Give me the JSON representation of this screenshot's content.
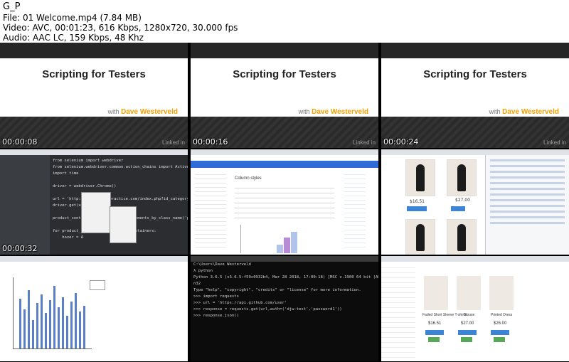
{
  "header": {
    "title": "G_P",
    "file": "File: 01 Welcome.mp4 (7.84 MB)",
    "video": "Video: AVC, 00:01:23, 616 Kbps, 1280x720, 30.000 fps",
    "audio": "Audio: AAC LC, 159 Kbps, 48 Khz"
  },
  "slide": {
    "title": "Scripting for Testers",
    "with": "with",
    "author": "Dave Westerveld",
    "watermark": "Linked in"
  },
  "thumbnails": [
    {
      "timestamp": "00:00:08"
    },
    {
      "timestamp": "00:00:16"
    },
    {
      "timestamp": "00:00:24"
    },
    {
      "timestamp": "00:00:32"
    },
    {
      "timestamp": ""
    },
    {
      "timestamp": ""
    },
    {
      "timestamp": ""
    },
    {
      "timestamp": ""
    },
    {
      "timestamp": ""
    }
  ],
  "ide": {
    "code": "from selenium import webdriver\nfrom selenium.webdriver.common.action_chains import ActionChains\nimport time\n\ndriver = webdriver.Chrome()\n\nurl = 'http://automationpractice.com/index.php?id_category=3&cont\ndriver.get(url)\n\nproduct_containers = driver.find_elements_by_class_name('product-\n\nfor product_container in product_containers:\n    hover = A"
  },
  "web": {
    "heading": "Column styles"
  },
  "shop": {
    "price1": "$16.51",
    "price2": "$27.00",
    "cart": "Add to cart",
    "more": "More"
  },
  "terminal": {
    "text": "C:\\Users\\Dave Westerveld\nλ python\nPython 3.6.5 (v3.6.5:f59c0932b4, Mar 28 2018, 17:00:18) [MSC v.1900 64 bit (AMD64)] on wi\nn32\nType \"help\", \"copyright\", \"credits\" or \"license\" for more information.\n>>> import requests\n>>> url = 'https://api.github.com/user'\n>>> response = requests.get(url,auth=('djw-test','password1'))\n>>> response.json()"
  },
  "shop2": {
    "p1": "Faded Short Sleeve T-shirts",
    "p2": "Blouse",
    "p3": "Printed Dress",
    "price1": "$16.51",
    "price2": "$27.00",
    "price3": "$26.00"
  }
}
